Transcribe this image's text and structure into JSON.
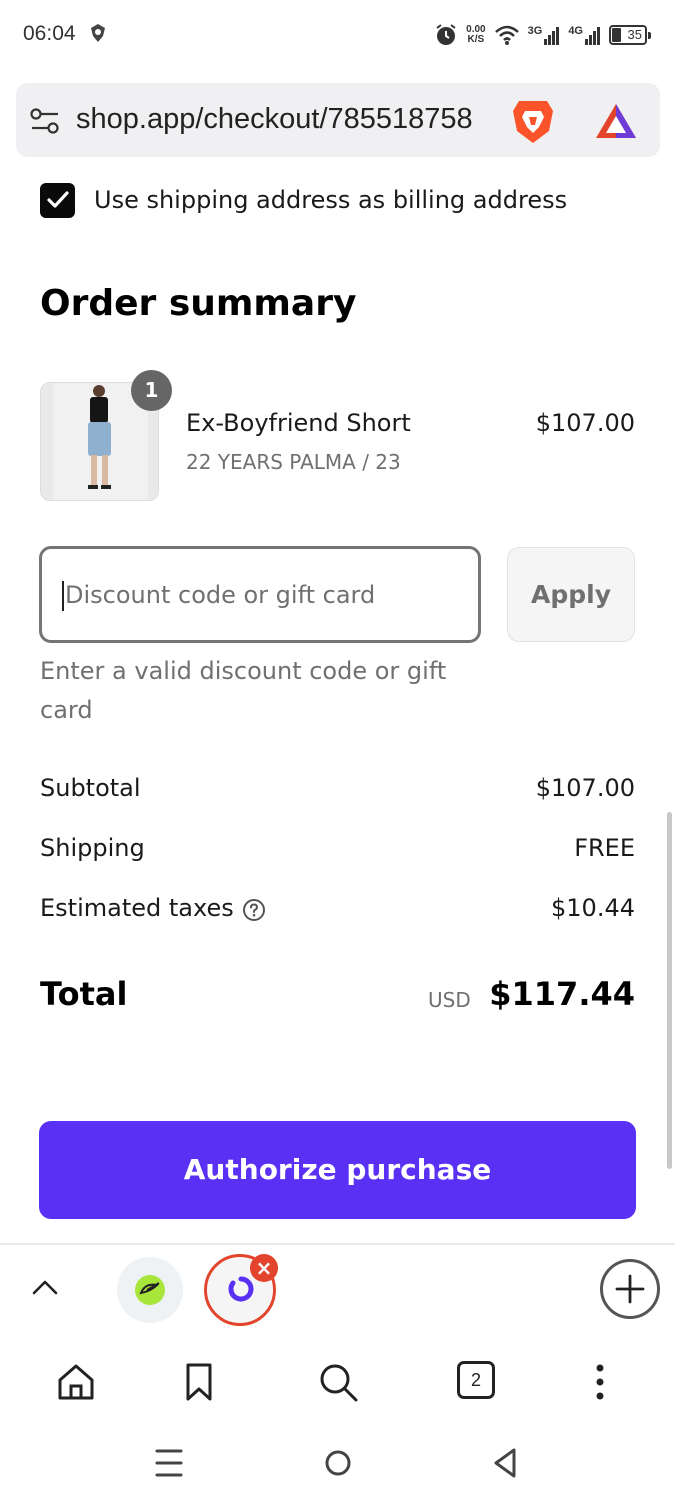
{
  "status_bar": {
    "time": "06:04",
    "net_speed_value": "0.00",
    "net_speed_unit": "K/S",
    "network_3g": "3G",
    "network_4g": "4G",
    "battery_level": "35"
  },
  "browser": {
    "url": "shop.app/checkout/785518758",
    "icons": [
      "tune-icon",
      "brave-icon",
      "atom-icon"
    ]
  },
  "billing": {
    "checked": true,
    "label": "Use shipping address as billing address"
  },
  "order_summary": {
    "title": "Order summary",
    "item": {
      "quantity": "1",
      "name": "Ex-Boyfriend Short",
      "variant": "22 YEARS PALMA / 23",
      "price": "$107.00"
    },
    "discount": {
      "placeholder": "Discount code or gift card",
      "apply_label": "Apply",
      "error": "Enter a valid discount code or gift card"
    },
    "lines": {
      "subtotal_label": "Subtotal",
      "subtotal_value": "$107.00",
      "shipping_label": "Shipping",
      "shipping_value": "FREE",
      "taxes_label": "Estimated taxes",
      "taxes_value": "$10.44"
    },
    "total": {
      "label": "Total",
      "currency": "USD",
      "value": "$117.44"
    },
    "authorize_label": "Authorize purchase"
  },
  "browser_toolbar": {
    "tab_count": "2"
  },
  "colors": {
    "accent": "#5a31f4",
    "close_badge": "#e2452b"
  }
}
